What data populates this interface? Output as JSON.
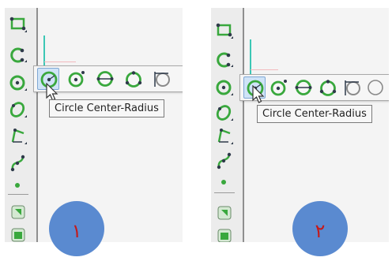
{
  "tooltip_text": "Circle Center-Radius",
  "panels": [
    {
      "badge": "١"
    },
    {
      "badge": "٢"
    }
  ],
  "colors": {
    "icon_green": "#39a83d",
    "icon_dark": "#2f3a4a",
    "badge_fill": "#5a8ad0",
    "badge_text": "#c41a1a",
    "axis_green": "#3cc7b5",
    "axis_red": "#f2b9bd",
    "selection": "#cfe3f7"
  },
  "toolbar_icons": [
    "rectangle-icon",
    "arc-icon",
    "circle-icon",
    "ellipse-icon",
    "polygon-icon",
    "spline-icon",
    "point-icon",
    "fillet-icon",
    "face-icon"
  ],
  "flyout_icons": [
    "circle-center-radius-icon",
    "circle-tangent-icon",
    "circle-diameter-icon",
    "circle-three-points-icon",
    "circle-tangent-line-icon",
    "circle-outline-icon"
  ]
}
